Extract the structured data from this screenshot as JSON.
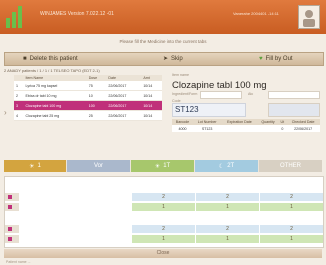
{
  "window": {
    "title": "WINJAMES Version 7.022.12 -01",
    "user": "Vanerahe 2004401 -14:11",
    "logo_icon": "bar-chart-logo-icon",
    "avatar_icon": "user-avatar-icon"
  },
  "page": {
    "subtitle": "Please fill the Medicine into the current tabs"
  },
  "actions": {
    "delete_label": "Delete this patient",
    "skip_label": "Skip",
    "fill_out_label": "Fill by Out",
    "delete_icon": "person-delete-icon",
    "skip_icon": "skip-icon",
    "fill_icon": "heart-fill-icon"
  },
  "left_panel": {
    "breadcrumb": "2 ANADY patients / 1 / 1 / 1  TELSEO TAPO (EDT 2-1)",
    "columns": [
      "",
      "Item Name",
      "Dose",
      "Date",
      "Amt"
    ],
    "rows": [
      {
        "num": "1",
        "name": "Lyrica 75 mg kapsel",
        "dose": "75",
        "date": "22/06/2017",
        "amt": "10/14"
      },
      {
        "num": "2",
        "name": "Ebixa dr tabl 10 mg",
        "dose": "10",
        "date": "22/06/2017",
        "amt": "10/14"
      },
      {
        "num": "3",
        "name": "Clozapine tabl 100 mg",
        "dose": "100",
        "date": "22/06/2017",
        "amt": "10/14"
      },
      {
        "num": "4",
        "name": "Clozapine tabl 25 mg",
        "dose": "25",
        "date": "22/06/2017",
        "amt": "10/14"
      }
    ]
  },
  "detail": {
    "item_label": "Item name",
    "drug_name": "Clozapine tabl 100 mg",
    "field1_label": "Ingredient/Form",
    "field2_label": "Atc",
    "code_label": "Code",
    "code": "ST123",
    "pkg_columns": [
      "Barcode",
      "Lot Number",
      "Expiration Date",
      "Quantity",
      "Ut",
      "Checked Date"
    ],
    "pkg_row": [
      "4000",
      "ST123",
      "",
      "",
      "0",
      "22/06/2017"
    ]
  },
  "slots": [
    {
      "label": "1",
      "icon": "sun-icon",
      "color": "#d3a43f"
    },
    {
      "label": "Vor",
      "icon": "",
      "color": "#aab8cc"
    },
    {
      "label": "1T",
      "icon": "sun-icon",
      "color": "#a7c76c"
    },
    {
      "label": "2T",
      "icon": "moon-icon",
      "color": "#a3cbe0"
    },
    {
      "label": "OTHER",
      "icon": "",
      "color": "#d8d0c3"
    }
  ],
  "grid": {
    "values_row_a": [
      "2",
      "2",
      "2",
      "2"
    ],
    "values_row_b": [
      "1",
      "1",
      "1",
      "1"
    ],
    "values_row_c": [
      "2",
      "2",
      "2",
      "2"
    ],
    "values_row_d": [
      "1",
      "1",
      "1",
      "1"
    ]
  },
  "footer": {
    "close_label": "Close",
    "status": "Patient name ..."
  },
  "colors": {
    "titlebar": "#d66a2e",
    "selected_row": "#c0307a",
    "dose_blue": "#d7e6f2",
    "dose_green": "#cfe6b5"
  }
}
